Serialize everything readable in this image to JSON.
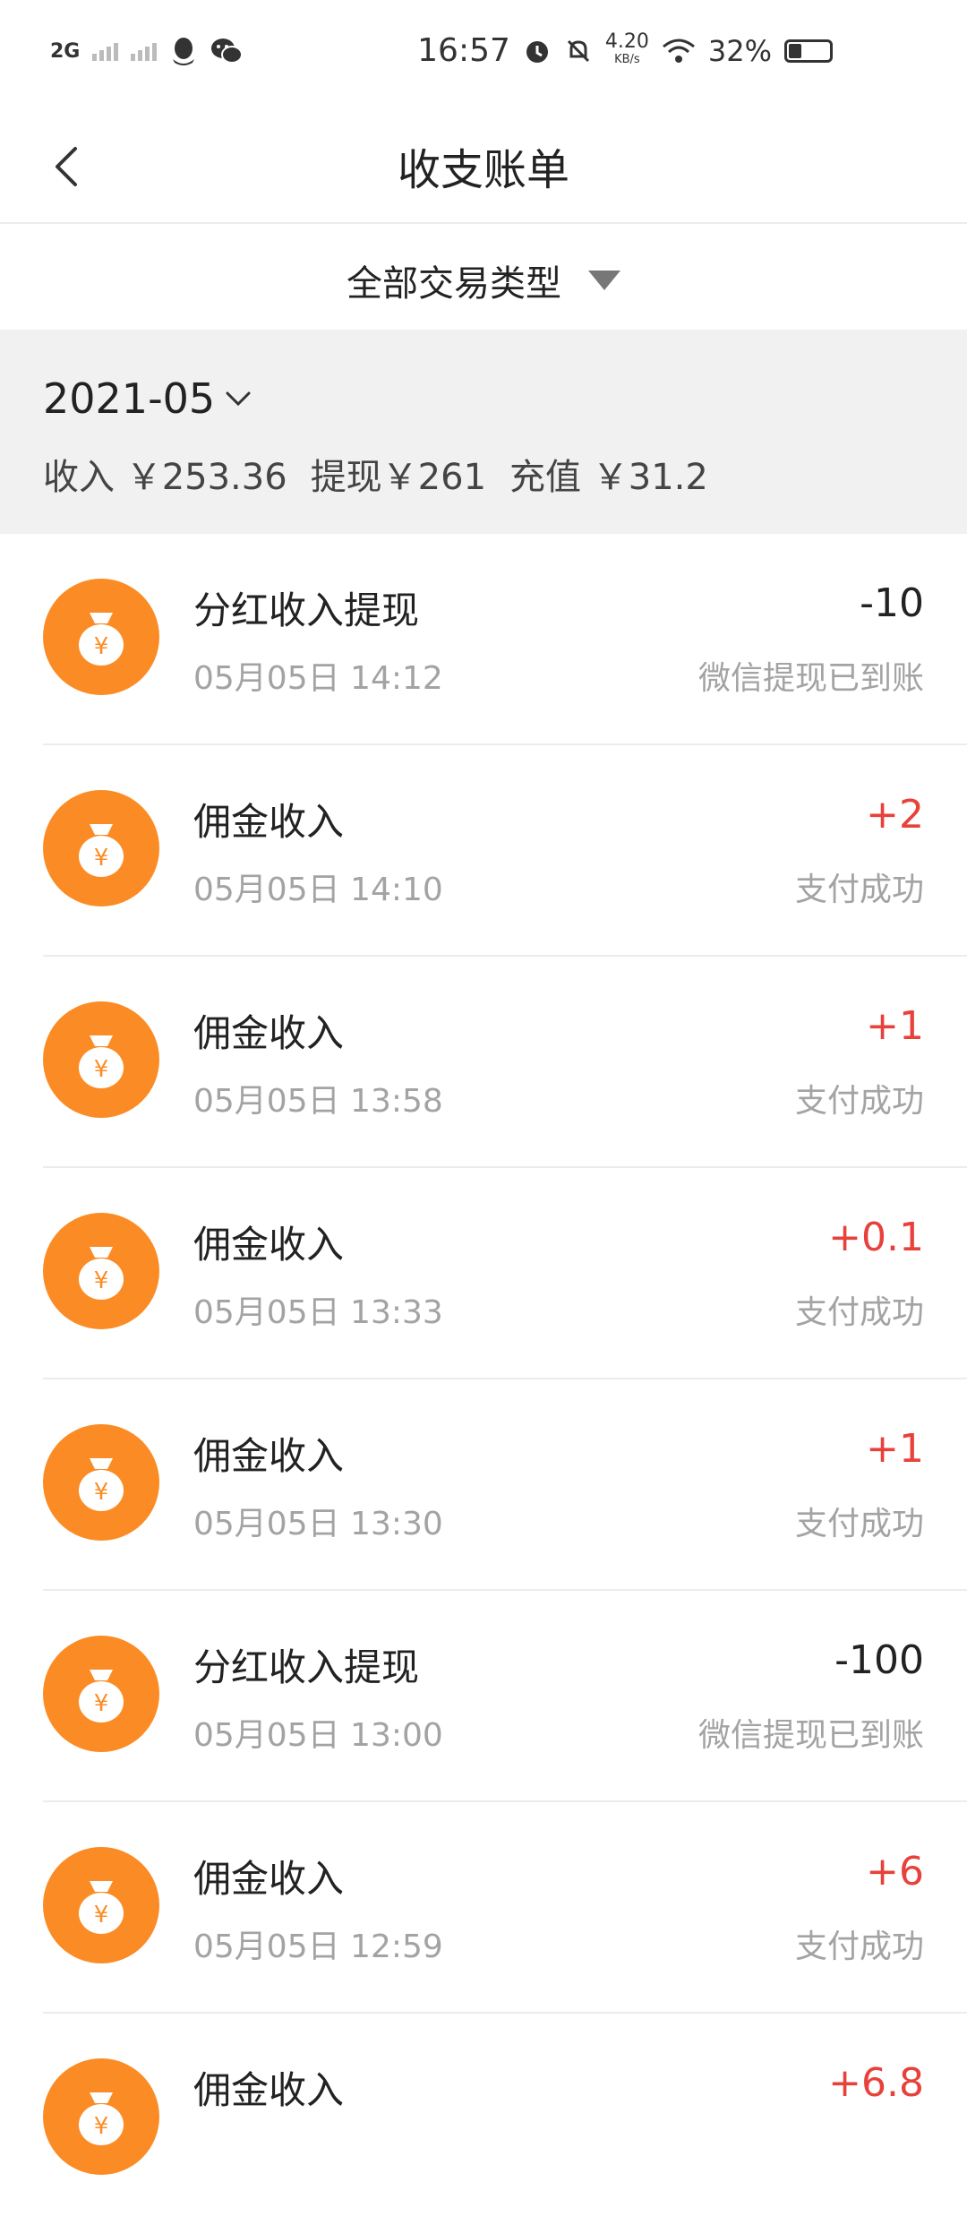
{
  "status_bar": {
    "network": "2G",
    "time": "16:57",
    "speed_value": "4.20",
    "speed_unit": "KB/s",
    "battery": "32%",
    "icons": [
      "signal-icon",
      "qq-icon",
      "wechat-icon",
      "alarm-icon",
      "mute-bell-icon",
      "wifi-icon",
      "battery-icon"
    ]
  },
  "header": {
    "title": "收支账单"
  },
  "filter": {
    "label": "全部交易类型"
  },
  "summary": {
    "month": "2021-05",
    "income": "收入 ￥253.36",
    "withdraw": "提现￥261",
    "recharge": "充值 ￥31.2"
  },
  "colors": {
    "accent_orange": "#fb8c25",
    "positive_red": "#e8413b",
    "summary_bg": "#f1f1f1"
  },
  "transactions": [
    {
      "title": "分红收入提现",
      "time": "05月05日 14:12",
      "amount": "-10",
      "status": "微信提现已到账",
      "type": "neg"
    },
    {
      "title": "佣金收入",
      "time": "05月05日 14:10",
      "amount": "+2",
      "status": "支付成功",
      "type": "pos"
    },
    {
      "title": "佣金收入",
      "time": "05月05日 13:58",
      "amount": "+1",
      "status": "支付成功",
      "type": "pos"
    },
    {
      "title": "佣金收入",
      "time": "05月05日 13:33",
      "amount": "+0.1",
      "status": "支付成功",
      "type": "pos"
    },
    {
      "title": "佣金收入",
      "time": "05月05日 13:30",
      "amount": "+1",
      "status": "支付成功",
      "type": "pos"
    },
    {
      "title": "分红收入提现",
      "time": "05月05日 13:00",
      "amount": "-100",
      "status": "微信提现已到账",
      "type": "neg"
    },
    {
      "title": "佣金收入",
      "time": "05月05日 12:59",
      "amount": "+6",
      "status": "支付成功",
      "type": "pos"
    },
    {
      "title": "佣金收入",
      "time": "",
      "amount": "+6.8",
      "status": "",
      "type": "pos"
    }
  ]
}
